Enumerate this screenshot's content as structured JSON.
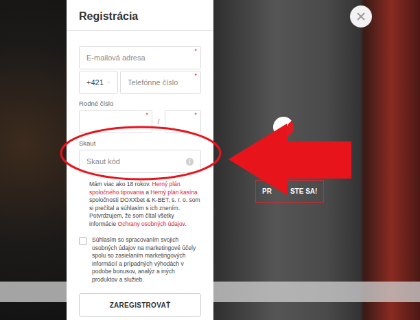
{
  "modal": {
    "title": "Registrácia",
    "required_mark": "*",
    "email": {
      "placeholder": "E-mailová adresa",
      "required": true
    },
    "phone": {
      "prefix": "+421",
      "placeholder": "Telefónne číslo",
      "required": true
    },
    "birth_number": {
      "label": "Rodné číslo",
      "separator": "/",
      "parts": [
        {
          "required": true
        },
        {
          "required": true
        }
      ]
    },
    "scout": {
      "label": "Skaut",
      "placeholder": "Skaut kód",
      "required": false
    },
    "consents": [
      {
        "kind": "plain",
        "segments": [
          {
            "text": "Mám viac ako 18 rokov. ",
            "link": false
          },
          {
            "text": "Herný plán spoločného tipovania",
            "link": true
          },
          {
            "text": " a ",
            "link": false
          },
          {
            "text": "Herný plán kasína",
            "link": true
          },
          {
            "text": " spoločnosti DOXXbet & K-BET, s. r. o. som si prečítal a súhlasím s ich znením. Potvrdzujem, že som čítal všetky informácie ",
            "link": false
          },
          {
            "text": "Ochrany osobných údajov",
            "link": true
          },
          {
            "text": ".",
            "link": false
          }
        ]
      },
      {
        "kind": "checkbox",
        "checked": false,
        "segments": [
          {
            "text": "Súhlasím so spracovaním svojich osobných údajov na marketingové účely spolu so zasielaním marketingových informácií a prípadných výhodách v podobe bonusov, analýz a iných produktov a služieb.",
            "link": false
          }
        ]
      }
    ],
    "submit": "ZAREGISTROVAŤ"
  },
  "background": {
    "login_button_visible_text": [
      "PR",
      "STE SA!"
    ]
  },
  "annotation": {
    "highlighted_field": "scout"
  }
}
